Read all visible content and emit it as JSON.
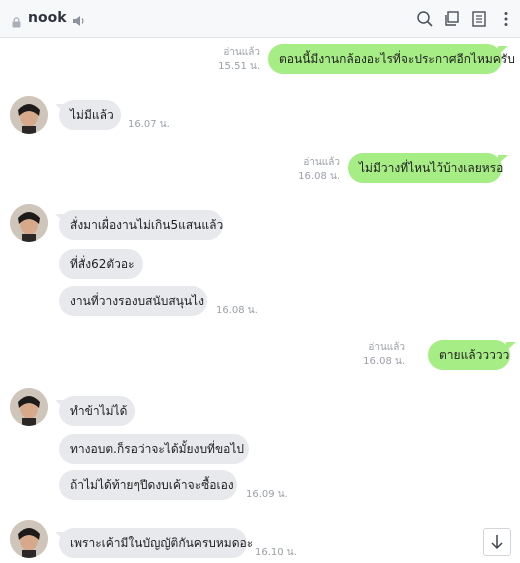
{
  "header": {
    "title": "nook",
    "icons": [
      "lock-icon",
      "speaker-icon",
      "search-icon",
      "copy-icon",
      "notes-icon",
      "more-icon"
    ]
  },
  "messages": [
    {
      "dir": "out",
      "text": "ตอนนี้มีงานกล้องอะไรที่จะประกาศอีกไหมครับ",
      "read": "อ่านแล้ว",
      "time": "15.51 น."
    },
    {
      "dir": "in",
      "text": "ไม่มีแล้ว",
      "time": "16.07 น."
    },
    {
      "dir": "out",
      "text": "ไม่มีวางที่ไหนไว้บ้างเลยหรอ",
      "read": "อ่านแล้ว",
      "time": "16.08 น."
    },
    {
      "dir": "in",
      "text": "สั่งมาเผื่องานไม่เกิน5แสนแล้ว"
    },
    {
      "dir": "in",
      "text": "ที่สั่ง62ตัวอะ"
    },
    {
      "dir": "in",
      "text": "งานที่วางรองบสนับสนุนไง",
      "time": "16.08 น."
    },
    {
      "dir": "out",
      "text": "ตายแล้ววววว",
      "read": "อ่านแล้ว",
      "time": "16.08 น."
    },
    {
      "dir": "in",
      "text": "ทำข้าไม่ได้"
    },
    {
      "dir": "in",
      "text": "ทางอบต.ก็รอว่าจะได้มั้ยงบที่ขอไป"
    },
    {
      "dir": "in",
      "text": "ถ้าไม่ได้ท้ายๆปีดงบเค้าจะซื้อเอง",
      "time": "16.09 น."
    },
    {
      "dir": "in",
      "text": "เพราะเค้ามีในบัญญัติกันครบหมดอะ",
      "time": "16.10 น."
    }
  ],
  "colors": {
    "outgoing_bubble": "#a7ed85",
    "incoming_bubble": "#e7e9ec",
    "meta_text": "#9aa0a8"
  }
}
